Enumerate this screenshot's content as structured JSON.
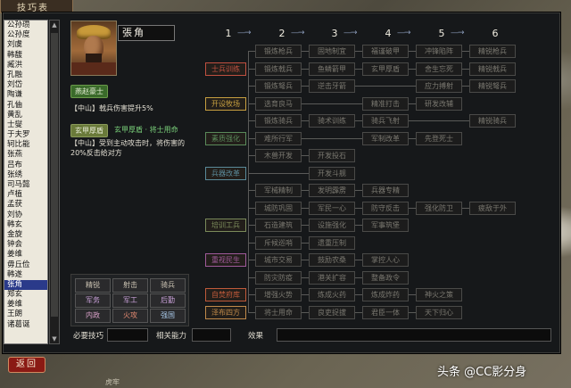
{
  "window_title": "技巧表",
  "officer_list": [
    "公孙瓒",
    "公孙度",
    "刘虞",
    "韩馥",
    "臧洪",
    "孔融",
    "刘岱",
    "陶谦",
    "孔伷",
    "黄乱",
    "士燮",
    "于夫罗",
    "轲比能",
    "张燕",
    "吕布",
    "张绣",
    "司马懿",
    "卢植",
    "孟获",
    "刘协",
    "韩玄",
    "金旋",
    "钟会",
    "姜维",
    "毋丘俭",
    "韩遂",
    "张角",
    "郑玄",
    "姜维",
    "王朗",
    "诸葛诞"
  ],
  "selected_officer_index": 26,
  "officer": {
    "name": "張角",
    "special_tag": "燕赵豪士",
    "special_desc": "【中山】戟兵伤害提升5%",
    "second_tag": "玄甲厚盾",
    "second_label": "玄甲厚盾 · 将士用命",
    "second_desc": "【中山】受到主动攻击时，将伤害的20%反击给对方"
  },
  "categories": [
    {
      "label": "精锐",
      "color": "#c8c0b0"
    },
    {
      "label": "射击",
      "color": "#c8c0b0"
    },
    {
      "label": "骑兵",
      "color": "#c8c0b0"
    },
    {
      "label": "军务",
      "color": "#c8a0d8"
    },
    {
      "label": "军工",
      "color": "#c8a0d8"
    },
    {
      "label": "后勤",
      "color": "#c8a0d8"
    },
    {
      "label": "内政",
      "color": "#d8a0c8"
    },
    {
      "label": "火攻",
      "color": "#e08870"
    },
    {
      "label": "强国",
      "color": "#a8c8e8"
    }
  ],
  "column_numbers": [
    "1",
    "2",
    "3",
    "4",
    "5",
    "6"
  ],
  "tree_rows": [
    {
      "label": "",
      "cells": [
        "锻炼枪兵",
        "固地制宜",
        "福谨破甲",
        "冲锋陷阵",
        "精锐枪兵"
      ]
    },
    {
      "label": "士兵训练",
      "cells": [
        "锻炼戟兵",
        "鱼鳞箭甲",
        "玄甲厚盾",
        "舍生忘死",
        "精锐戟兵"
      ]
    },
    {
      "label": "",
      "cells": [
        "锻炼弩兵",
        "逆击牙箭",
        "",
        "应力搏射",
        "精锐弩兵"
      ]
    },
    {
      "label": "开设牧场",
      "cells": [
        "选育良马",
        "",
        "精准打击",
        "研发改辅",
        ""
      ]
    },
    {
      "label": "",
      "cells": [
        "锻炼骑兵",
        "骑术训练",
        "骑兵飞射",
        "",
        "精锐骑兵"
      ]
    },
    {
      "label": "素质强化",
      "cells": [
        "难所行军",
        "",
        "军制改革",
        "先登死士",
        ""
      ]
    },
    {
      "label": "",
      "cells": [
        "木兽开发",
        "开发投石",
        "",
        "",
        ""
      ]
    },
    {
      "label": "兵器改革",
      "cells": [
        "",
        "开发斗舰",
        "",
        "",
        ""
      ]
    },
    {
      "label": "",
      "cells": [
        "军械精制",
        "发明霹雳",
        "兵器专精",
        "",
        ""
      ]
    },
    {
      "label": "",
      "cells": [
        "城防巩固",
        "军民一心",
        "防守反击",
        "强化防卫",
        "疲敌于外"
      ]
    },
    {
      "label": "培训工兵",
      "cells": [
        "石造建筑",
        "设施强化",
        "军事筑堡",
        "",
        ""
      ]
    },
    {
      "label": "",
      "cells": [
        "斥候巡哨",
        "遗重压制",
        "",
        "",
        ""
      ]
    },
    {
      "label": "重视民生",
      "cells": [
        "城市交易",
        "鼓励农桑",
        "掌控人心",
        "",
        ""
      ]
    },
    {
      "label": "",
      "cells": [
        "防灾防疫",
        "港关扩容",
        "整备政令",
        "",
        ""
      ]
    },
    {
      "label": "自焚府库",
      "cells": [
        "增强火势",
        "炼成火药",
        "炼成炸药",
        "神火之策",
        ""
      ]
    },
    {
      "label": "泽布四方",
      "cells": [
        "将士用命",
        "良吏捉拔",
        "君臣一体",
        "天下归心",
        ""
      ]
    }
  ],
  "row_label_colors": {
    "士兵训练": "#c05040",
    "开设牧场": "#c8a040",
    "素质强化": "#5a8a5a",
    "兵器改革": "#5a8a9a",
    "培训工兵": "#7a8a5a",
    "重视民生": "#a05a9a",
    "自焚府库": "#c05a3a",
    "泽布四方": "#c08a4a"
  },
  "bottom": {
    "required_label": "必要技巧",
    "related_label": "相关能力",
    "effect_label": "效果"
  },
  "back_button": "返回",
  "watermark": "头条 @CC影分身",
  "bottom_text": "虎牢"
}
